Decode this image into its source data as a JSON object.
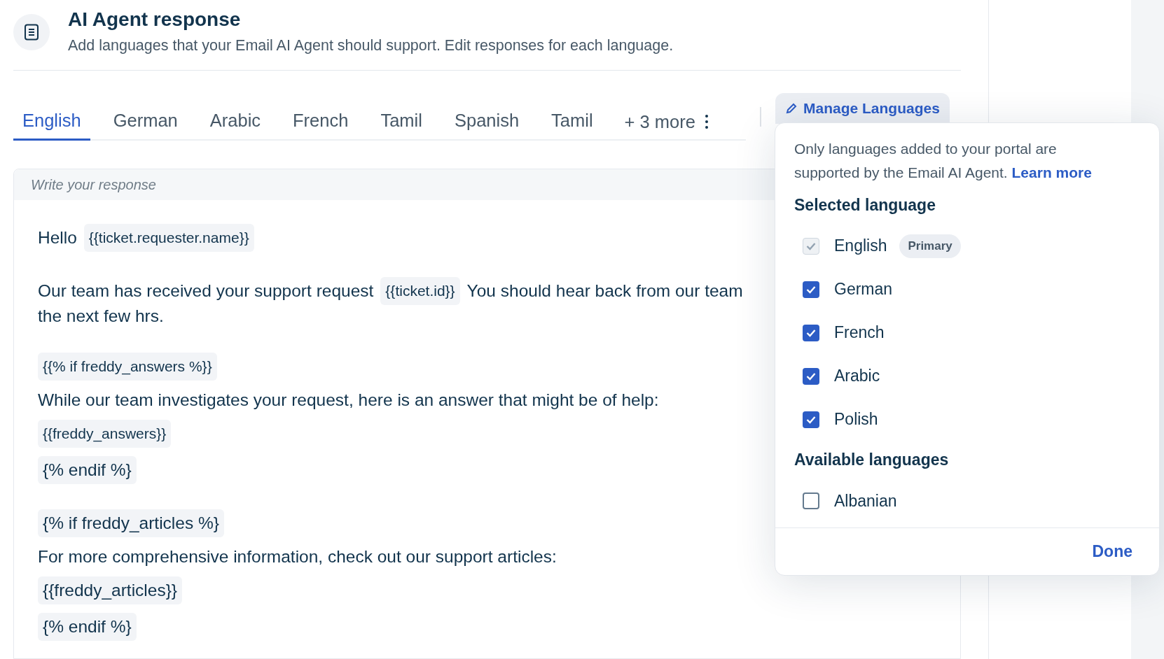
{
  "header": {
    "title": "AI Agent response",
    "subtitle": "Add languages that your Email AI Agent should support. Edit responses for each language."
  },
  "tabs": [
    {
      "label": "English",
      "selected": true
    },
    {
      "label": "German",
      "selected": false
    },
    {
      "label": "Arabic",
      "selected": false
    },
    {
      "label": "French",
      "selected": false
    },
    {
      "label": "Tamil",
      "selected": false
    },
    {
      "label": "Spanish",
      "selected": false
    },
    {
      "label": "Tamil",
      "selected": false
    }
  ],
  "more_tabs": "+ 3 more",
  "manage_button": "Manage Languages",
  "editor": {
    "placeholder": "Write your response",
    "groups": [
      [
        {
          "lines": [
            [
              {
                "kind": "text",
                "text": "Hello"
              },
              {
                "kind": "token",
                "text": "{{ticket.requester.name}}"
              }
            ]
          ]
        }
      ],
      [
        {
          "lines": [
            [
              {
                "kind": "text",
                "text": "Our team has received your support request"
              },
              {
                "kind": "token",
                "text": "{{ticket.id}}"
              },
              {
                "kind": "text",
                "text": "You should hear back from our team"
              }
            ],
            [
              {
                "kind": "text",
                "text": "the next few hrs."
              }
            ]
          ]
        }
      ],
      [
        {
          "lines": [
            [
              {
                "kind": "token",
                "text": "{{% if freddy_answers %}}"
              }
            ]
          ]
        },
        {
          "lines": [
            [
              {
                "kind": "text",
                "text": "While our team investigates your request, here is an answer that might be of help:"
              }
            ]
          ]
        },
        {
          "lines": [
            [
              {
                "kind": "token",
                "text": "{{freddy_answers}}"
              }
            ]
          ]
        },
        {
          "lines": [
            [
              {
                "kind": "tag",
                "text": "{% endif %}"
              }
            ]
          ]
        }
      ],
      [
        {
          "lines": [
            [
              {
                "kind": "tag",
                "text": "{% if freddy_articles %}"
              }
            ]
          ]
        },
        {
          "lines": [
            [
              {
                "kind": "text",
                "text": "For more comprehensive information, check out our support articles:"
              }
            ]
          ]
        },
        {
          "lines": [
            [
              {
                "kind": "tag",
                "text": "{{freddy_articles}}"
              }
            ]
          ]
        },
        {
          "lines": [
            [
              {
                "kind": "tag",
                "text": "{% endif %}"
              }
            ]
          ]
        }
      ]
    ]
  },
  "popover": {
    "note": "Only languages added to your portal are supported by the Email AI Agent.",
    "link": "Learn more",
    "selected_heading": "Selected language",
    "selected_languages": [
      {
        "label": "English",
        "checked": true,
        "disabled": true,
        "badge": "Primary"
      },
      {
        "label": "German",
        "checked": true,
        "disabled": false
      },
      {
        "label": "French",
        "checked": true,
        "disabled": false
      },
      {
        "label": "Arabic",
        "checked": true,
        "disabled": false
      },
      {
        "label": "Polish",
        "checked": true,
        "disabled": false
      }
    ],
    "available_heading": "Available languages",
    "available_languages": [
      {
        "label": "Albanian",
        "checked": false,
        "disabled": false
      }
    ],
    "done": "Done"
  }
}
